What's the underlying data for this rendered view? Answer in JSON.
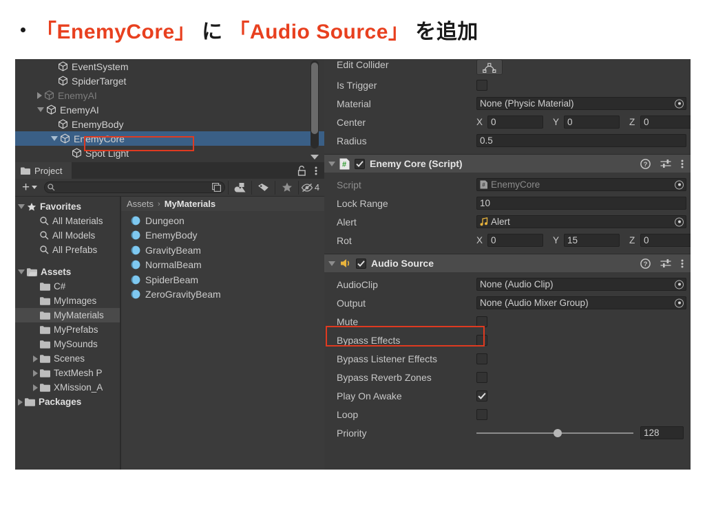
{
  "slide": {
    "title_part1": "「EnemyCore」",
    "title_part2": " に ",
    "title_part3": "「Audio Source」",
    "title_part4": " を追加"
  },
  "hierarchy": {
    "items": [
      {
        "label": "EventSystem",
        "indent": 2,
        "arrow": "none",
        "dim": false,
        "selected": false
      },
      {
        "label": "SpiderTarget",
        "indent": 2,
        "arrow": "none",
        "dim": false,
        "selected": false
      },
      {
        "label": "EnemyAI",
        "indent": 1,
        "arrow": "right",
        "dim": true,
        "selected": false
      },
      {
        "label": "EnemyAI",
        "indent": 1,
        "arrow": "down",
        "dim": false,
        "selected": false
      },
      {
        "label": "EnemyBody",
        "indent": 2,
        "arrow": "none",
        "dim": false,
        "selected": false
      },
      {
        "label": "EnemyCore",
        "indent": 2,
        "arrow": "down",
        "dim": false,
        "selected": true
      },
      {
        "label": "Spot Light",
        "indent": 3,
        "arrow": "none",
        "dim": false,
        "selected": false
      }
    ]
  },
  "project": {
    "tab_label": "Project",
    "search_placeholder": "",
    "search_value": "",
    "hidden_count": "4",
    "breadcrumb": {
      "root": "Assets",
      "separator": "›",
      "current": "MyMaterials"
    },
    "tree": [
      {
        "label": "Favorites",
        "type": "favorites-root",
        "indent": 0,
        "arrow": "down",
        "bold": true,
        "selected": false
      },
      {
        "label": "All Materials",
        "type": "search",
        "indent": 1,
        "arrow": "none",
        "bold": false,
        "selected": false
      },
      {
        "label": "All Models",
        "type": "search",
        "indent": 1,
        "arrow": "none",
        "bold": false,
        "selected": false
      },
      {
        "label": "All Prefabs",
        "type": "search",
        "indent": 1,
        "arrow": "none",
        "bold": false,
        "selected": false
      },
      {
        "label": "",
        "type": "gap",
        "indent": 0,
        "arrow": "none",
        "bold": false,
        "selected": false
      },
      {
        "label": "Assets",
        "type": "folder-open",
        "indent": 0,
        "arrow": "down",
        "bold": true,
        "selected": false
      },
      {
        "label": "C#",
        "type": "folder",
        "indent": 1,
        "arrow": "none",
        "bold": false,
        "selected": false
      },
      {
        "label": "MyImages",
        "type": "folder",
        "indent": 1,
        "arrow": "none",
        "bold": false,
        "selected": false
      },
      {
        "label": "MyMaterials",
        "type": "folder",
        "indent": 1,
        "arrow": "none",
        "bold": false,
        "selected": true
      },
      {
        "label": "MyPrefabs",
        "type": "folder",
        "indent": 1,
        "arrow": "none",
        "bold": false,
        "selected": false
      },
      {
        "label": "MySounds",
        "type": "folder",
        "indent": 1,
        "arrow": "none",
        "bold": false,
        "selected": false
      },
      {
        "label": "Scenes",
        "type": "folder",
        "indent": 1,
        "arrow": "right",
        "bold": false,
        "selected": false
      },
      {
        "label": "TextMesh P",
        "type": "folder",
        "indent": 1,
        "arrow": "right",
        "bold": false,
        "selected": false
      },
      {
        "label": "XMission_A",
        "type": "folder",
        "indent": 1,
        "arrow": "right",
        "bold": false,
        "selected": false
      },
      {
        "label": "Packages",
        "type": "folder",
        "indent": 0,
        "arrow": "right",
        "bold": true,
        "selected": false
      }
    ],
    "assets": [
      {
        "label": "Dungeon"
      },
      {
        "label": "EnemyBody"
      },
      {
        "label": "GravityBeam"
      },
      {
        "label": "NormalBeam"
      },
      {
        "label": "SpiderBeam"
      },
      {
        "label": "ZeroGravityBeam"
      }
    ]
  },
  "inspector": {
    "collider": {
      "edit_collider_label": "Edit Collider",
      "rows": [
        {
          "label": "Is Trigger",
          "kind": "checkbox",
          "checked": false
        },
        {
          "label": "Material",
          "kind": "objref",
          "value": "None (Physic Material)"
        },
        {
          "label": "Center",
          "kind": "vec3",
          "x": "0",
          "y": "0",
          "z": "0"
        },
        {
          "label": "Radius",
          "kind": "text",
          "value": "0.5"
        }
      ]
    },
    "enemy_core": {
      "title": "Enemy Core (Script)",
      "enabled": true,
      "icon": "script-icon",
      "rows": [
        {
          "label": "Script",
          "kind": "objref",
          "value": "EnemyCore",
          "dim": true,
          "icon": "script-mini-icon"
        },
        {
          "label": "Lock Range",
          "kind": "text",
          "value": "10"
        },
        {
          "label": "Alert",
          "kind": "objref",
          "value": "Alert",
          "icon": "audio-clip-icon"
        },
        {
          "label": "Rot",
          "kind": "vec3",
          "x": "0",
          "y": "15",
          "z": "0"
        }
      ]
    },
    "audio_source": {
      "title": "Audio Source",
      "enabled": true,
      "icon": "speaker-icon",
      "rows": [
        {
          "label": "AudioClip",
          "kind": "objref",
          "value": "None (Audio Clip)"
        },
        {
          "label": "Output",
          "kind": "objref",
          "value": "None (Audio Mixer Group)"
        },
        {
          "label": "Mute",
          "kind": "checkbox",
          "checked": false
        },
        {
          "label": "Bypass Effects",
          "kind": "checkbox",
          "checked": false
        },
        {
          "label": "Bypass Listener Effects",
          "kind": "checkbox",
          "checked": false
        },
        {
          "label": "Bypass Reverb Zones",
          "kind": "checkbox",
          "checked": false
        },
        {
          "label": "Play On Awake",
          "kind": "checkbox",
          "checked": true
        },
        {
          "label": "Loop",
          "kind": "checkbox",
          "checked": false
        },
        {
          "label": "Priority",
          "kind": "slider",
          "value": "128"
        }
      ]
    },
    "header_icons": {
      "help": "help-icon",
      "preset": "preset-icon",
      "menu": "kebab-menu-icon"
    }
  },
  "colors": {
    "accent_red": "#e8401f",
    "highlight_box": "#e03a20",
    "selection_blue": "#3a5f86",
    "panel_bg": "#383838",
    "component_header": "#4b4b4b",
    "speaker_icon": "#e8b33c",
    "script_icon_green": "#3fa33f",
    "material_sphere": "#7ec8f0"
  }
}
